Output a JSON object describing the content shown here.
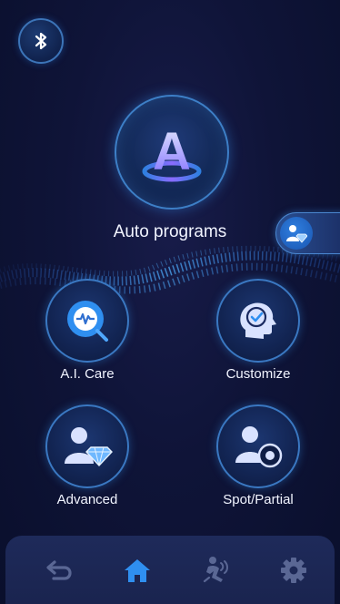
{
  "header": {
    "bluetooth_icon": "bluetooth-icon"
  },
  "main": {
    "label": "Auto programs",
    "letter": "A",
    "icon": "auto-program-icon"
  },
  "side_tab": {
    "icon": "user-diamond-icon"
  },
  "features": [
    {
      "label": "A.I. Care",
      "icon": "ai-scan-icon"
    },
    {
      "label": "Customize",
      "icon": "head-check-icon"
    },
    {
      "label": "Advanced",
      "icon": "user-diamond-icon"
    },
    {
      "label": "Spot/Partial",
      "icon": "user-target-icon"
    }
  ],
  "nav": {
    "items": [
      {
        "icon": "back-icon",
        "active": false
      },
      {
        "icon": "home-icon",
        "active": true
      },
      {
        "icon": "massage-icon",
        "active": false
      },
      {
        "icon": "settings-icon",
        "active": false
      }
    ]
  },
  "colors": {
    "background": "#0c1130",
    "accent": "#2f8ff0",
    "ring": "#3d7fc7",
    "inactive_icon": "#5a6794"
  }
}
